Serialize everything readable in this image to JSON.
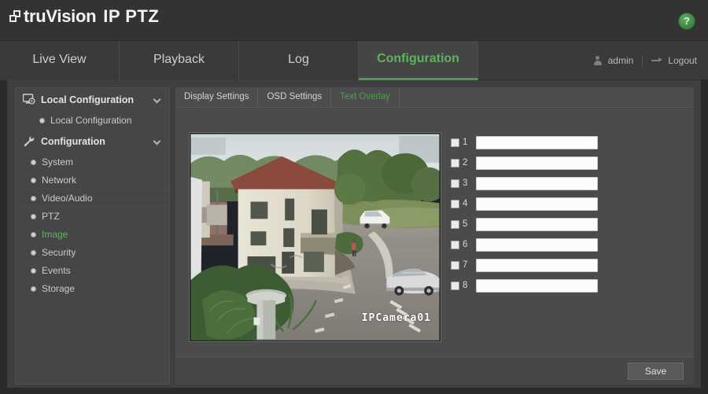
{
  "header": {
    "brand": "truVision",
    "model": "IP PTZ",
    "logo_icon": "stacked-squares-logo",
    "help_icon": "question-mark-icon",
    "help_label": "?"
  },
  "nav": {
    "tabs": [
      {
        "label": "Live View",
        "active": false
      },
      {
        "label": "Playback",
        "active": false
      },
      {
        "label": "Log",
        "active": false
      },
      {
        "label": "Configuration",
        "active": true
      }
    ],
    "user": {
      "icon": "user-icon",
      "name": "admin"
    },
    "logout": {
      "icon": "logout-icon",
      "label": "Logout"
    }
  },
  "sidebar": {
    "groups": [
      {
        "label": "Local Configuration",
        "icon": "monitor-gear-icon",
        "chevron": "chevron-down-icon",
        "items": [
          {
            "label": "Local Configuration",
            "active": false
          }
        ]
      },
      {
        "label": "Configuration",
        "icon": "wrench-icon",
        "chevron": "chevron-down-icon",
        "items": [
          {
            "label": "System",
            "active": false
          },
          {
            "label": "Network",
            "active": false
          },
          {
            "label": "Video/Audio",
            "active": false
          },
          {
            "label": "PTZ",
            "active": false
          },
          {
            "label": "Image",
            "active": true
          },
          {
            "label": "Security",
            "active": false
          },
          {
            "label": "Events",
            "active": false
          },
          {
            "label": "Storage",
            "active": false
          }
        ]
      }
    ]
  },
  "content": {
    "tabs": [
      {
        "label": "Display Settings",
        "active": false
      },
      {
        "label": "OSD Settings",
        "active": false
      },
      {
        "label": "Text Overlay",
        "active": true
      }
    ],
    "preview": {
      "osd_text": "IPCamera01",
      "scene_description": "Live camera view of a beige two-story building on a street corner with trees, a white van and a silver SUV on the road"
    },
    "overlay_rows": [
      {
        "number": "1",
        "checked": false,
        "value": "",
        "placeholder": ""
      },
      {
        "number": "2",
        "checked": false,
        "value": "",
        "placeholder": ""
      },
      {
        "number": "3",
        "checked": false,
        "value": "",
        "placeholder": ""
      },
      {
        "number": "4",
        "checked": false,
        "value": "",
        "placeholder": ""
      },
      {
        "number": "5",
        "checked": false,
        "value": "",
        "placeholder": ""
      },
      {
        "number": "6",
        "checked": false,
        "value": "",
        "placeholder": ""
      },
      {
        "number": "7",
        "checked": false,
        "value": "",
        "placeholder": ""
      },
      {
        "number": "8",
        "checked": false,
        "value": "",
        "placeholder": ""
      }
    ],
    "save_label": "Save"
  },
  "colors": {
    "accent_green": "#5eb25e",
    "header_bg": "#333333",
    "nav_bg": "#3a3a3a",
    "panel_bg": "#4b4b4b",
    "sidebar_bg": "#464646"
  }
}
